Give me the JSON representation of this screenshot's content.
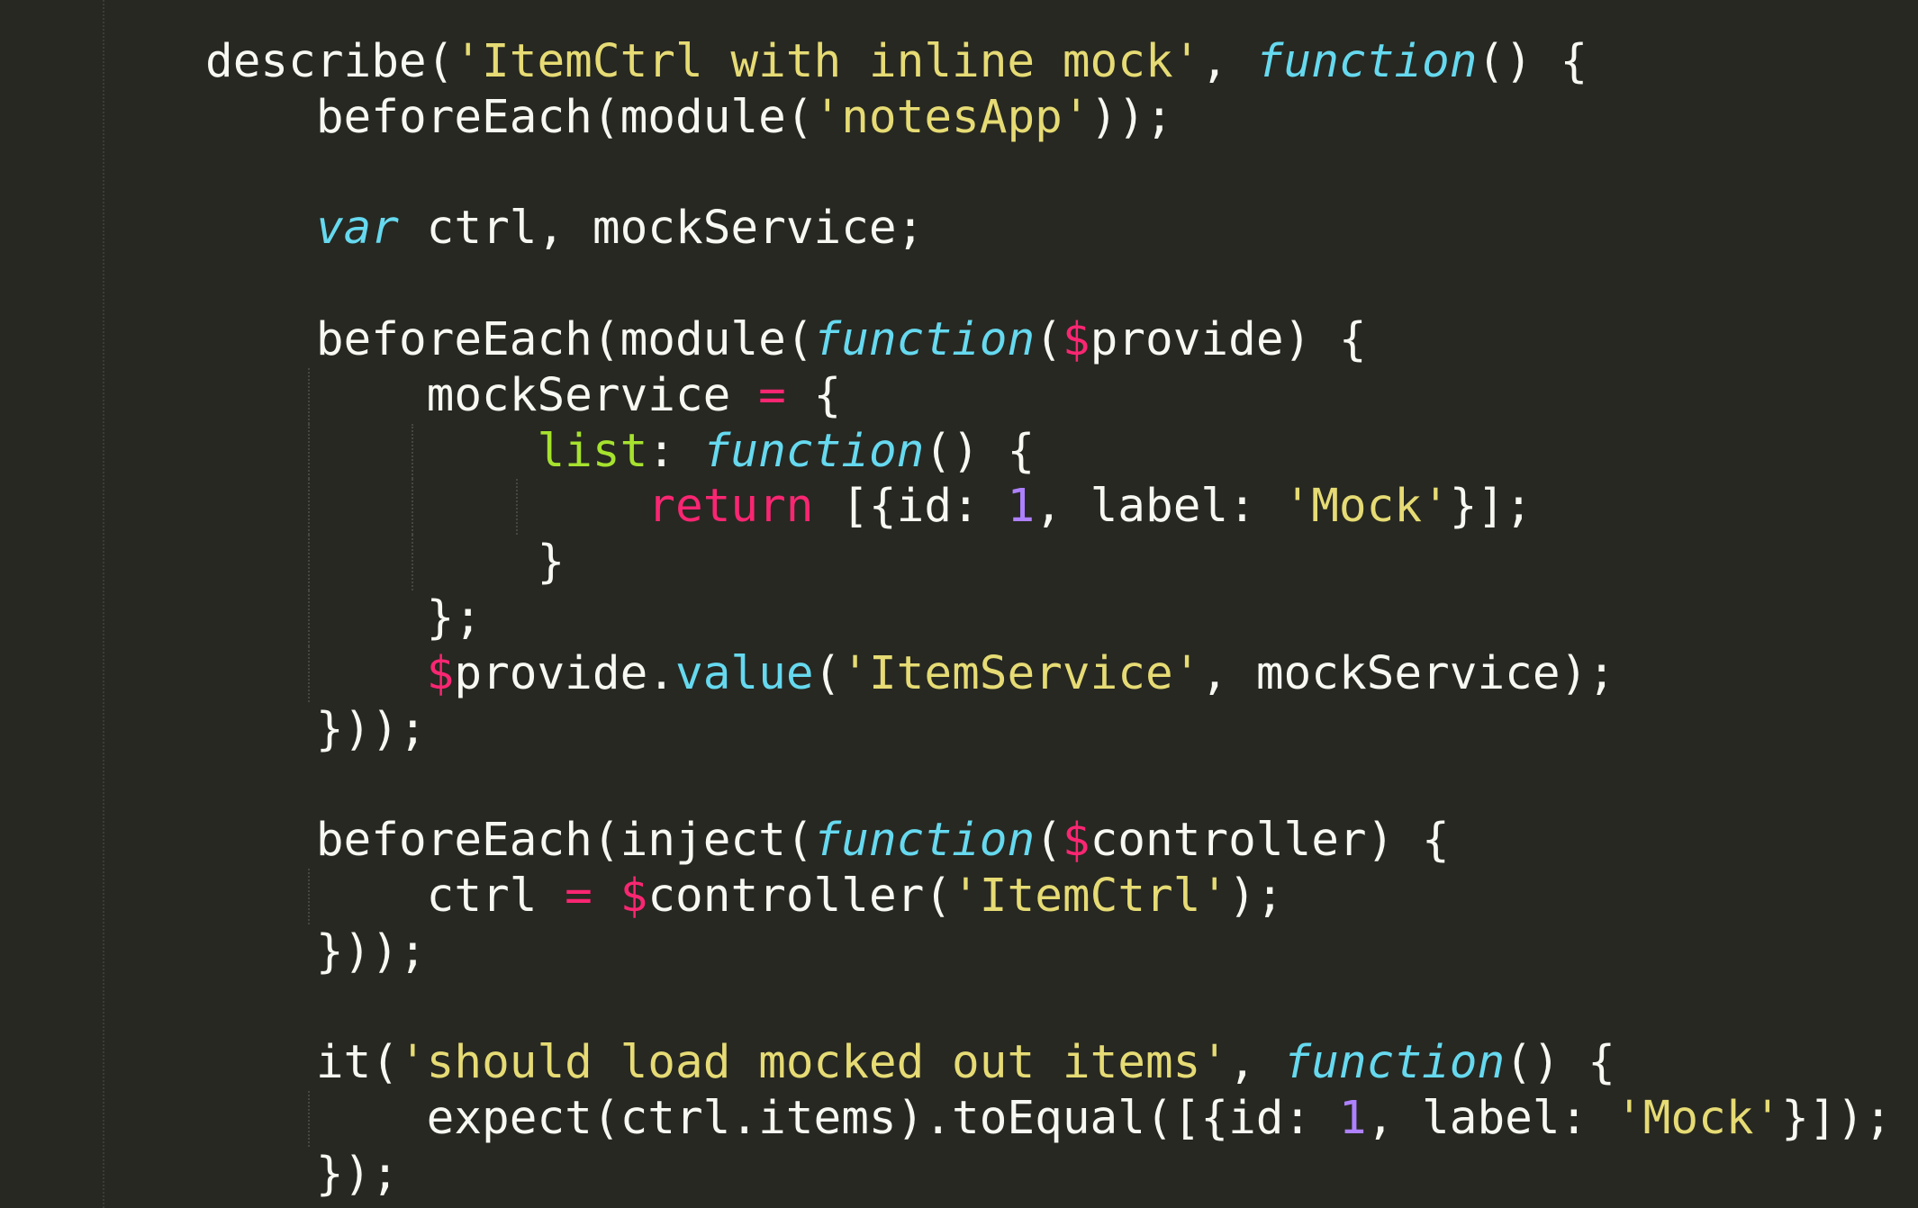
{
  "editor": {
    "language": "javascript",
    "theme": "monokai",
    "colors": {
      "background": "#272822",
      "text": "#f8f8f2",
      "string": "#e6db74",
      "function_keyword": "#66d9ef",
      "keyword": "#f92672",
      "number": "#ae81ff",
      "property": "#a6e22e",
      "method": "#66d9ef"
    },
    "lines": [
      {
        "indent": 0,
        "tokens": [
          {
            "t": "describe(",
            "k": "plain"
          },
          {
            "t": "'ItemCtrl with inline mock'",
            "k": "str"
          },
          {
            "t": ", ",
            "k": "plain"
          },
          {
            "t": "function",
            "k": "fnkw"
          },
          {
            "t": "() {",
            "k": "plain"
          }
        ]
      },
      {
        "indent": 1,
        "tokens": [
          {
            "t": "beforeEach(module(",
            "k": "plain"
          },
          {
            "t": "'notesApp'",
            "k": "str"
          },
          {
            "t": "));",
            "k": "plain"
          }
        ]
      },
      {
        "indent": 0,
        "tokens": []
      },
      {
        "indent": 1,
        "tokens": [
          {
            "t": "var",
            "k": "fnkw"
          },
          {
            "t": " ctrl, mockService;",
            "k": "plain"
          }
        ]
      },
      {
        "indent": 0,
        "tokens": []
      },
      {
        "indent": 1,
        "tokens": [
          {
            "t": "beforeEach(module(",
            "k": "plain"
          },
          {
            "t": "function",
            "k": "fnkw"
          },
          {
            "t": "(",
            "k": "plain"
          },
          {
            "t": "$",
            "k": "kw"
          },
          {
            "t": "provide) {",
            "k": "plain"
          }
        ]
      },
      {
        "indent": 2,
        "tokens": [
          {
            "t": "mockService ",
            "k": "plain"
          },
          {
            "t": "=",
            "k": "kw"
          },
          {
            "t": " {",
            "k": "plain"
          }
        ]
      },
      {
        "indent": 3,
        "tokens": [
          {
            "t": "list",
            "k": "prop"
          },
          {
            "t": ": ",
            "k": "plain"
          },
          {
            "t": "function",
            "k": "fnkw"
          },
          {
            "t": "() {",
            "k": "plain"
          }
        ]
      },
      {
        "indent": 4,
        "tokens": [
          {
            "t": "return",
            "k": "kw"
          },
          {
            "t": " [{id: ",
            "k": "plain"
          },
          {
            "t": "1",
            "k": "num"
          },
          {
            "t": ", label: ",
            "k": "plain"
          },
          {
            "t": "'Mock'",
            "k": "str"
          },
          {
            "t": "}];",
            "k": "plain"
          }
        ]
      },
      {
        "indent": 3,
        "tokens": [
          {
            "t": "}",
            "k": "plain"
          }
        ]
      },
      {
        "indent": 2,
        "tokens": [
          {
            "t": "};",
            "k": "plain"
          }
        ]
      },
      {
        "indent": 2,
        "tokens": [
          {
            "t": "$",
            "k": "kw"
          },
          {
            "t": "provide.",
            "k": "plain"
          },
          {
            "t": "value",
            "k": "method"
          },
          {
            "t": "(",
            "k": "plain"
          },
          {
            "t": "'ItemService'",
            "k": "str"
          },
          {
            "t": ", mockService);",
            "k": "plain"
          }
        ]
      },
      {
        "indent": 1,
        "tokens": [
          {
            "t": "}));",
            "k": "plain"
          }
        ]
      },
      {
        "indent": 0,
        "tokens": []
      },
      {
        "indent": 1,
        "tokens": [
          {
            "t": "beforeEach(inject(",
            "k": "plain"
          },
          {
            "t": "function",
            "k": "fnkw"
          },
          {
            "t": "(",
            "k": "plain"
          },
          {
            "t": "$",
            "k": "kw"
          },
          {
            "t": "controller) {",
            "k": "plain"
          }
        ]
      },
      {
        "indent": 2,
        "tokens": [
          {
            "t": "ctrl ",
            "k": "plain"
          },
          {
            "t": "=",
            "k": "kw"
          },
          {
            "t": " ",
            "k": "plain"
          },
          {
            "t": "$",
            "k": "kw"
          },
          {
            "t": "controller(",
            "k": "plain"
          },
          {
            "t": "'ItemCtrl'",
            "k": "str"
          },
          {
            "t": ");",
            "k": "plain"
          }
        ]
      },
      {
        "indent": 1,
        "tokens": [
          {
            "t": "}));",
            "k": "plain"
          }
        ]
      },
      {
        "indent": 0,
        "tokens": []
      },
      {
        "indent": 1,
        "tokens": [
          {
            "t": "it(",
            "k": "plain"
          },
          {
            "t": "'should load mocked out items'",
            "k": "str"
          },
          {
            "t": ", ",
            "k": "plain"
          },
          {
            "t": "function",
            "k": "fnkw"
          },
          {
            "t": "() {",
            "k": "plain"
          }
        ]
      },
      {
        "indent": 2,
        "tokens": [
          {
            "t": "expect(ctrl.items).toEqual([{id: ",
            "k": "plain"
          },
          {
            "t": "1",
            "k": "num"
          },
          {
            "t": ", label: ",
            "k": "plain"
          },
          {
            "t": "'Mock'",
            "k": "str"
          },
          {
            "t": "}]);",
            "k": "plain"
          }
        ]
      },
      {
        "indent": 1,
        "tokens": [
          {
            "t": "});",
            "k": "plain"
          }
        ]
      }
    ]
  }
}
